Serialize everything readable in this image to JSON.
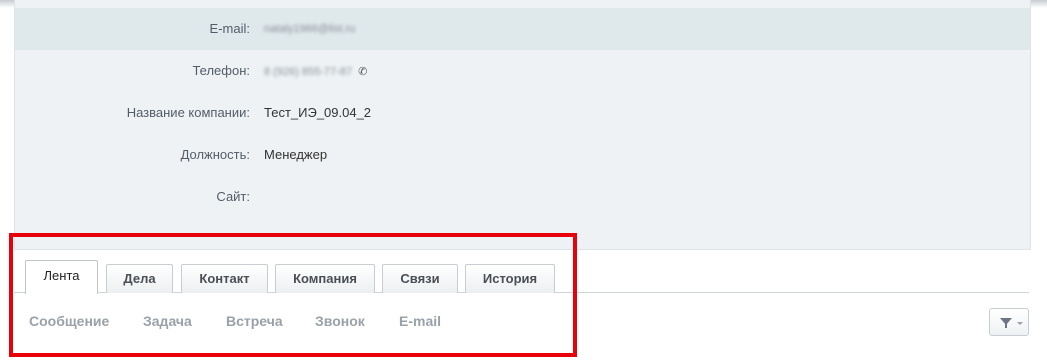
{
  "details": {
    "fields": [
      {
        "label": "E-mail:",
        "value": "nataly1966@list.ru",
        "blurred": true
      },
      {
        "label": "Телефон:",
        "value": "8 (926) 855-77-87",
        "blurred": true,
        "icon": "phone-icon"
      },
      {
        "label": "Название компании:",
        "value": "Тест_ИЭ_09.04_2",
        "blurred": false
      },
      {
        "label": "Должность:",
        "value": "Менеджер",
        "blurred": false
      },
      {
        "label": "Сайт:",
        "value": "",
        "blurred": false
      }
    ]
  },
  "tabs": [
    {
      "label": "Лента",
      "active": true
    },
    {
      "label": "Дела",
      "active": false
    },
    {
      "label": "Контакт",
      "active": false
    },
    {
      "label": "Компания",
      "active": false
    },
    {
      "label": "Связи",
      "active": false
    },
    {
      "label": "История",
      "active": false
    }
  ],
  "actions": [
    "Сообщение",
    "Задача",
    "Встреча",
    "Звонок",
    "E-mail"
  ],
  "filter": {
    "icon": "funnel-icon",
    "caret": "chevron-down-icon"
  },
  "colors": {
    "highlight": "#e8000b",
    "card_bg": "#eef2f4",
    "row_highlight": "#dfe8eb"
  }
}
